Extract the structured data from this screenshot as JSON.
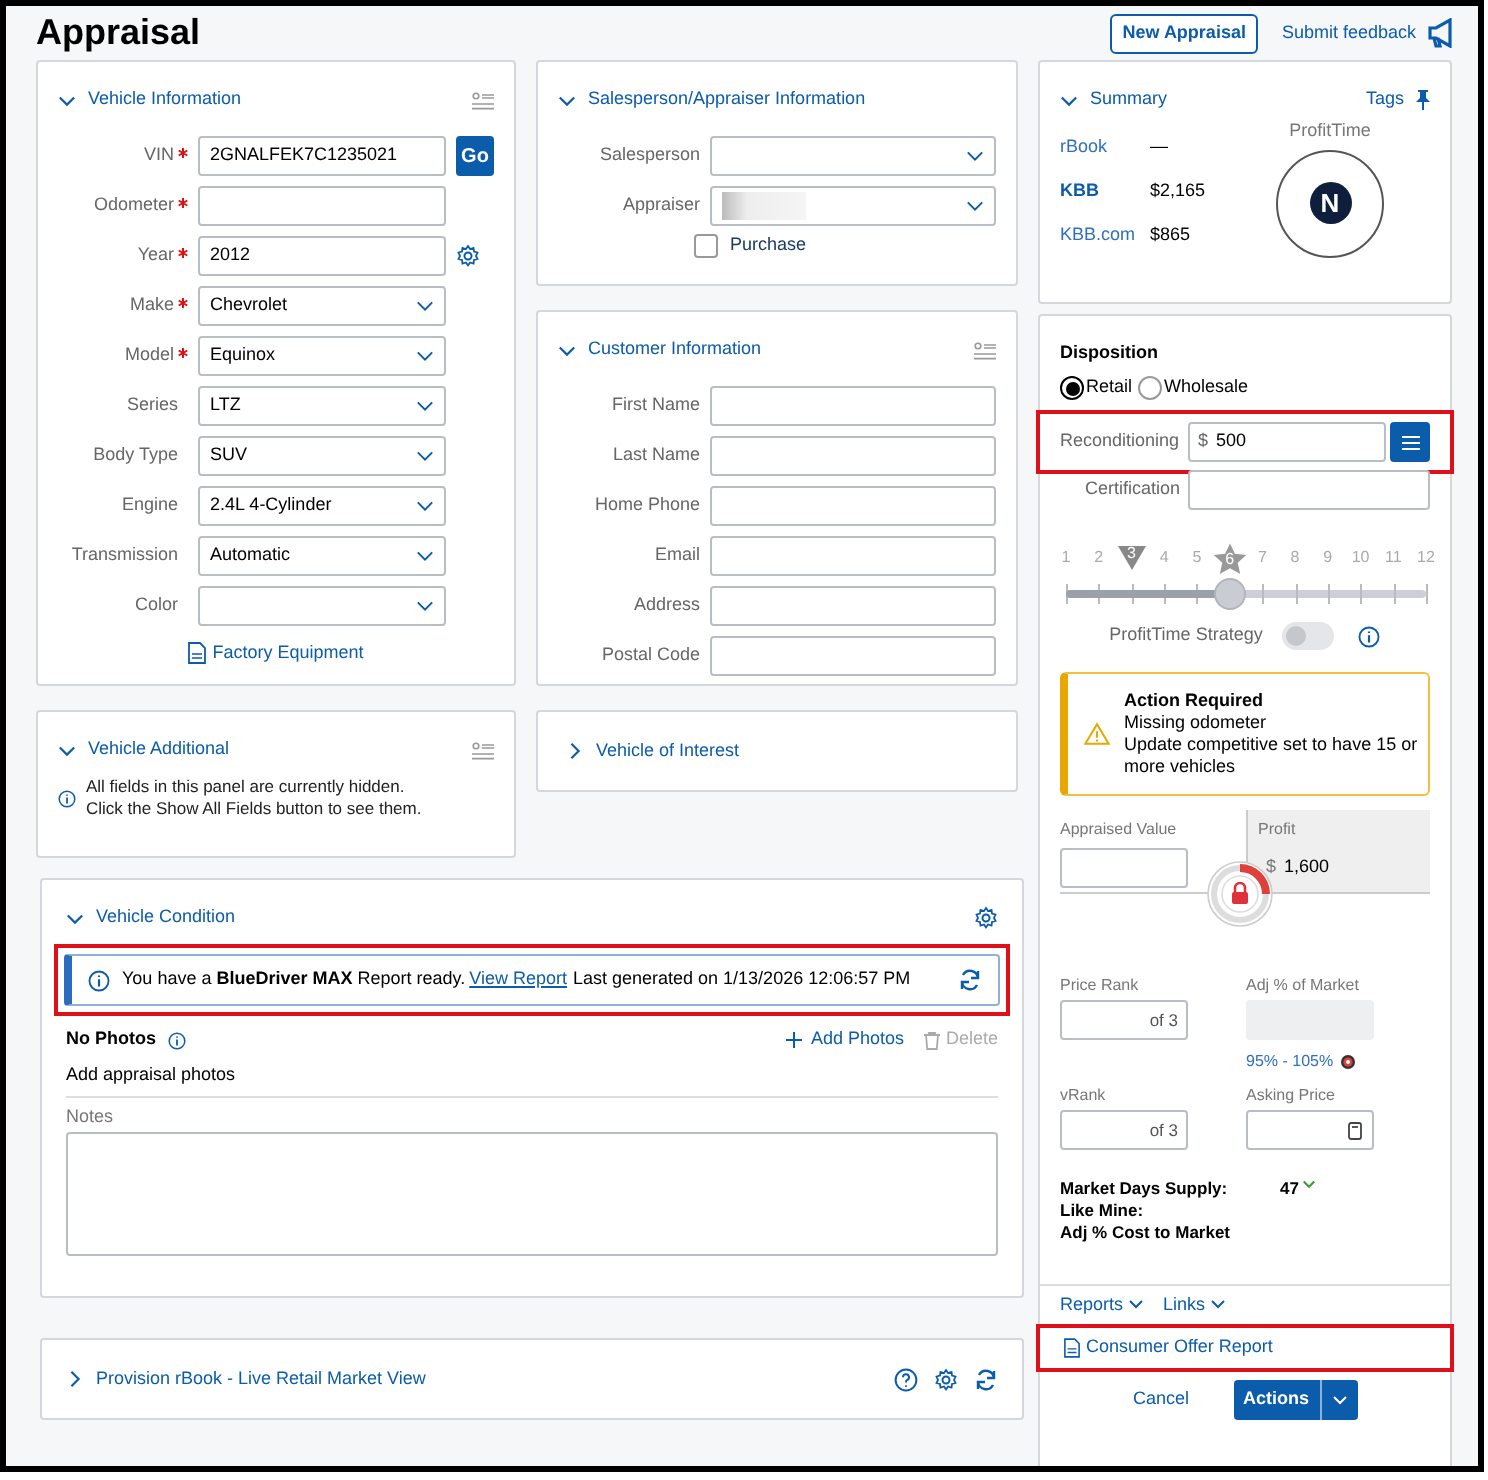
{
  "page_title": "Appraisal",
  "header_actions": {
    "new_appraisal": "New Appraisal",
    "feedback": "Submit feedback"
  },
  "vehicle_information": {
    "title": "Vehicle Information",
    "expanded": true,
    "fields": [
      {
        "label": "VIN",
        "required": true,
        "kind": "text",
        "value": "2GNALFEK7C1235021",
        "button": "Go"
      },
      {
        "label": "Odometer",
        "required": true,
        "kind": "text"
      },
      {
        "label": "Year",
        "required": true,
        "kind": "text_settings",
        "value": "2012"
      },
      {
        "label": "Make",
        "required": true,
        "kind": "select",
        "value": "Chevrolet"
      },
      {
        "label": "Model",
        "required": true,
        "kind": "select",
        "value": "Equinox"
      },
      {
        "label": "Series",
        "required": false,
        "kind": "select",
        "value": "LTZ"
      },
      {
        "label": "Body Type",
        "required": false,
        "kind": "select",
        "value": "SUV"
      },
      {
        "label": "Engine",
        "required": false,
        "kind": "select",
        "value": "2.4L 4-Cylinder"
      },
      {
        "label": "Transmission",
        "required": false,
        "kind": "select",
        "value": "Automatic"
      },
      {
        "label": "Color",
        "required": false,
        "kind": "select"
      }
    ],
    "link": "Factory Equipment"
  },
  "vehicle_additional": {
    "title": "Vehicle Additional",
    "expanded": true,
    "message": "All fields in this panel are currently hidden. Click the Show All Fields button to see them."
  },
  "salesperson_appraiser": {
    "title": "Salesperson/Appraiser Information",
    "expanded": true,
    "fields": [
      {
        "label": "Salesperson",
        "kind": "select"
      },
      {
        "label": "Appraiser",
        "kind": "select_redacted"
      }
    ],
    "purchase": {
      "label": "Purchase",
      "checked": false
    }
  },
  "customer_information": {
    "title": "Customer Information",
    "expanded": true,
    "fields": [
      "First Name",
      "Last Name",
      "Home Phone",
      "Email",
      "Address",
      "Postal Code"
    ]
  },
  "vehicle_of_interest": {
    "title": "Vehicle of Interest",
    "expanded": false
  },
  "vehicle_condition": {
    "title": "Vehicle Condition",
    "expanded": true,
    "notice": {
      "highlighted": true,
      "text_before": "You have a **BlueDriver MAX** Report ready.",
      "link": "View Report",
      "text_after": "Last generated on 1/13/2026 12:06:57 PM"
    },
    "photos_title": "No Photos",
    "add_photos": "Add Photos",
    "delete": "Delete",
    "photos_hint": "Add appraisal photos",
    "notes_label": "Notes"
  },
  "provision_rbook": {
    "title": "Provision rBook - Live Retail Market View",
    "expanded": false
  },
  "summary": {
    "title": "Summary",
    "expanded": true,
    "tags": "Tags",
    "rows": [
      {
        "source": "rBook",
        "kind": "link",
        "value": "—"
      },
      {
        "source": "KBB",
        "kind": "bold",
        "value": "$2,165"
      },
      {
        "source": "KBB.com",
        "kind": "link",
        "value": "$865"
      }
    ],
    "profit_time_label": "ProfitTime",
    "profit_time_badge": "N"
  },
  "disposition": {
    "title": "Disposition",
    "options": [
      {
        "label": "Retail",
        "selected": true
      },
      {
        "label": "Wholesale",
        "selected": false
      }
    ],
    "reconditioning": {
      "label": "Reconditioning",
      "currency": "$",
      "value": "500",
      "highlighted": true
    },
    "certification": {
      "label": "Certification"
    },
    "slider": {
      "ticks": [
        {
          "label": "1",
          "kind": "plain"
        },
        {
          "label": "2",
          "kind": "plain"
        },
        {
          "label": "3",
          "kind": "triangle"
        },
        {
          "label": "4",
          "kind": "plain"
        },
        {
          "label": "5",
          "kind": "plain"
        },
        {
          "label": "6",
          "kind": "star"
        },
        {
          "label": "7",
          "kind": "plain"
        },
        {
          "label": "8",
          "kind": "plain"
        },
        {
          "label": "9",
          "kind": "plain"
        },
        {
          "label": "10",
          "kind": "plain"
        },
        {
          "label": "11",
          "kind": "plain"
        },
        {
          "label": "12",
          "kind": "plain"
        }
      ],
      "level": 0.455
    },
    "strategy": {
      "label": "ProfitTime Strategy",
      "on": false
    },
    "alert": {
      "title": "Action Required",
      "lines": [
        "Missing odometer",
        "Update competitive set to have 15 or more vehicles"
      ]
    },
    "appraised_value": {
      "label": "Appraised Value"
    },
    "profit": {
      "label": "Profit",
      "currency": "$",
      "value": "1,600"
    },
    "price_rank": {
      "label": "Price Rank",
      "suffix": "of 3"
    },
    "adj_market": {
      "label": "Adj % of Market",
      "range": "95% - 105%"
    },
    "vrank": {
      "label": "vRank",
      "suffix": "of 3"
    },
    "asking_price": {
      "label": "Asking Price"
    },
    "market_labels": [
      "Market Days Supply:",
      "Like Mine:",
      "Adj % Cost to Market"
    ],
    "market_value": "47",
    "menus": [
      "Reports",
      "Links"
    ],
    "consumer_offer": {
      "label": "Consumer Offer Report",
      "highlighted": true
    },
    "cancel": "Cancel",
    "actions": "Actions"
  }
}
